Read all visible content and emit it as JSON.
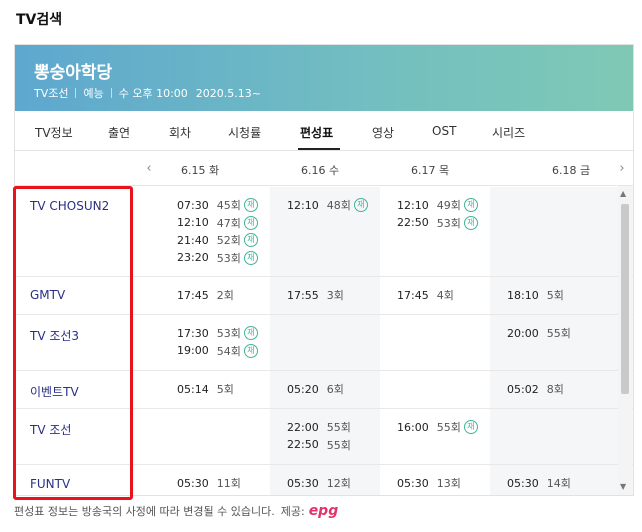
{
  "search_title": "TV검색",
  "program": {
    "title": "뽕숭아학당",
    "channel": "TV조선",
    "genre": "예능",
    "schedule": "수 오후 10:00",
    "start": "2020.5.13~"
  },
  "tabs": [
    "TV정보",
    "출연",
    "회차",
    "시청률",
    "편성표",
    "영상",
    "OST",
    "시리즈"
  ],
  "active_tab": "편성표",
  "nav": {
    "prev": "‹",
    "next": "›"
  },
  "dates": [
    "6.15 화",
    "6.16 수",
    "6.17 목",
    "6.18 금"
  ],
  "re_label": "재",
  "rows": [
    {
      "channel": "TV CHOSUN2",
      "days": [
        [
          {
            "time": "07:30",
            "ep": "45회",
            "re": true
          },
          {
            "time": "12:10",
            "ep": "47회",
            "re": true
          },
          {
            "time": "21:40",
            "ep": "52회",
            "re": true
          },
          {
            "time": "23:20",
            "ep": "53회",
            "re": true
          }
        ],
        [
          {
            "time": "12:10",
            "ep": "48회",
            "re": true
          }
        ],
        [
          {
            "time": "12:10",
            "ep": "49회",
            "re": true
          },
          {
            "time": "22:50",
            "ep": "53회",
            "re": true
          }
        ],
        []
      ]
    },
    {
      "channel": "GMTV",
      "days": [
        [
          {
            "time": "17:45",
            "ep": "2회",
            "re": false
          }
        ],
        [
          {
            "time": "17:55",
            "ep": "3회",
            "re": false
          }
        ],
        [
          {
            "time": "17:45",
            "ep": "4회",
            "re": false
          }
        ],
        [
          {
            "time": "18:10",
            "ep": "5회",
            "re": false
          }
        ]
      ]
    },
    {
      "channel": "TV 조선3",
      "days": [
        [
          {
            "time": "17:30",
            "ep": "53회",
            "re": true
          },
          {
            "time": "19:00",
            "ep": "54회",
            "re": true
          }
        ],
        [],
        [],
        [
          {
            "time": "20:00",
            "ep": "55회",
            "re": false
          }
        ]
      ]
    },
    {
      "channel": "이벤트TV",
      "days": [
        [
          {
            "time": "05:14",
            "ep": "5회",
            "re": false
          }
        ],
        [
          {
            "time": "05:20",
            "ep": "6회",
            "re": false
          }
        ],
        [],
        [
          {
            "time": "05:02",
            "ep": "8회",
            "re": false
          }
        ]
      ]
    },
    {
      "channel": "TV 조선",
      "days": [
        [],
        [
          {
            "time": "22:00",
            "ep": "55회",
            "re": false
          },
          {
            "time": "22:50",
            "ep": "55회",
            "re": false
          }
        ],
        [
          {
            "time": "16:00",
            "ep": "55회",
            "re": true
          }
        ],
        []
      ]
    },
    {
      "channel": "FUNTV",
      "days": [
        [
          {
            "time": "05:30",
            "ep": "11회",
            "re": false
          }
        ],
        [
          {
            "time": "05:30",
            "ep": "12회",
            "re": false
          }
        ],
        [
          {
            "time": "05:30",
            "ep": "13회",
            "re": false
          }
        ],
        [
          {
            "time": "05:30",
            "ep": "14회",
            "re": false
          }
        ]
      ]
    }
  ],
  "footer": {
    "note": "편성표 정보는 방송국의 사정에 따라 변경될 수 있습니다.",
    "provider_label": "제공:",
    "provider": "epg"
  },
  "colors": {
    "banner_start": "#5ea7cf",
    "banner_end": "#7fc9b4",
    "channel_text": "#2a2f86",
    "re_badge": "#42b39a",
    "highlight_box": "#e8141c"
  }
}
